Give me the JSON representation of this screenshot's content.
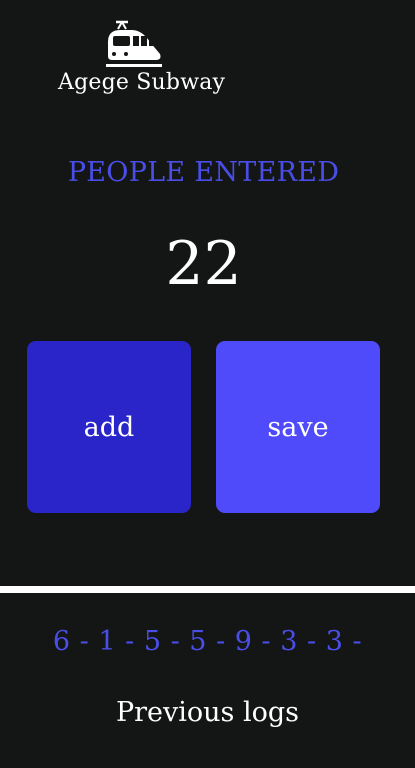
{
  "brand": {
    "name": "Agege Subway",
    "icon": "train-icon"
  },
  "counter": {
    "label": "PEOPLE ENTERED",
    "value": "22"
  },
  "actions": {
    "add_label": "add",
    "save_label": "save"
  },
  "logs": {
    "entries_text": "6 - 1 - 5 - 5 - 9 - 3 - 3 -",
    "title": "Previous logs"
  },
  "colors": {
    "background": "#141616",
    "accent_text": "#4a4ee8",
    "add_button": "#2a25c8",
    "save_button": "#4f4bfb",
    "divider": "#ffffff"
  }
}
